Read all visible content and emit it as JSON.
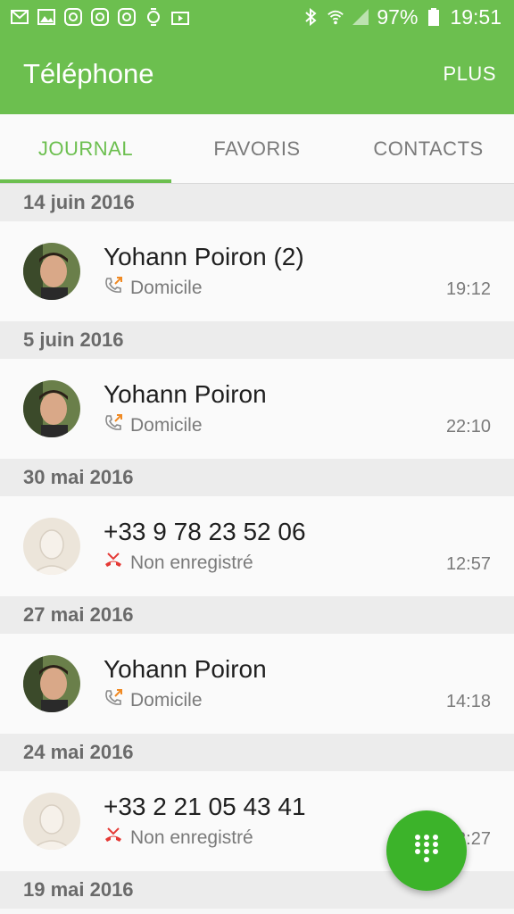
{
  "status": {
    "battery": "97%",
    "time": "19:51"
  },
  "app": {
    "title": "Téléphone",
    "more": "PLUS"
  },
  "tabs": [
    "JOURNAL",
    "FAVORIS",
    "CONTACTS"
  ],
  "calls": [
    {
      "date": "14 juin 2016",
      "name": "Yohann Poiron (2)",
      "label": "Domicile",
      "time": "19:12"
    },
    {
      "date": "5 juin 2016",
      "name": "Yohann Poiron",
      "label": "Domicile",
      "time": "22:10"
    },
    {
      "date": "30 mai 2016",
      "name": "+33 9 78 23 52 06",
      "label": "Non enregistré",
      "time": "12:57"
    },
    {
      "date": "27 mai 2016",
      "name": "Yohann Poiron",
      "label": "Domicile",
      "time": "14:18"
    },
    {
      "date": "24 mai 2016",
      "name": "+33 2 21 05 43 41",
      "label": "Non enregistré",
      "time": "12:27"
    }
  ],
  "last_date": "19 mai 2016",
  "colors": {
    "accent": "#6cbf4f",
    "fab": "#3cb32a",
    "missed": "#e53935",
    "outgoing": "#f08a24"
  }
}
